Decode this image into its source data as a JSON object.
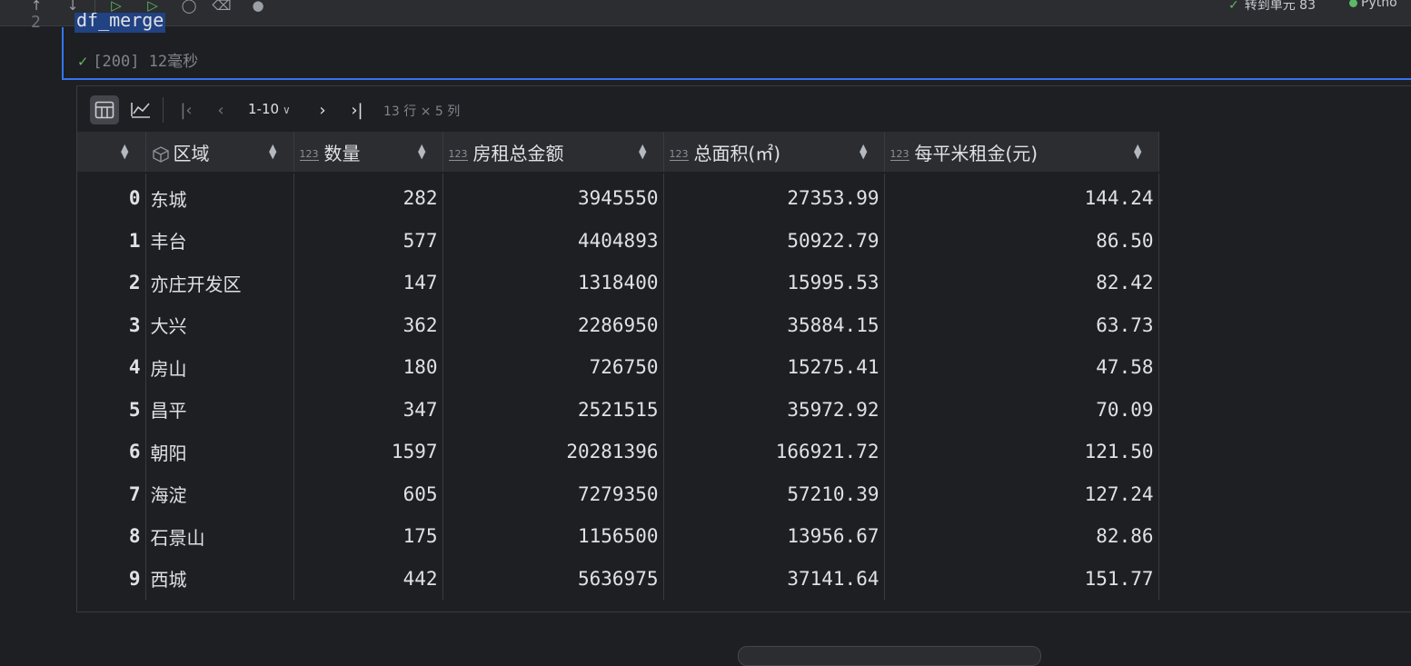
{
  "topbar": {
    "goto_text": "转到单元 83",
    "kernel_text": "Pytho"
  },
  "cell": {
    "line_number": "2",
    "code": "df_merge",
    "status_exec_count": "[200]",
    "status_duration": "12毫秒"
  },
  "output_toolbar": {
    "page_range": "1-10",
    "dims": "13 行 × 5 列"
  },
  "table": {
    "columns": [
      {
        "label": "区域",
        "type": "object"
      },
      {
        "label": "数量",
        "type": "123"
      },
      {
        "label": "房租总金额",
        "type": "123"
      },
      {
        "label": "总面积(㎡)",
        "type": "123"
      },
      {
        "label": "每平米租金(元)",
        "type": "123"
      }
    ],
    "rows": [
      {
        "index": "0",
        "region": "东城",
        "count": "282",
        "total_rent": "3945550",
        "total_area": "27353.99",
        "rent_per_sqm": "144.24"
      },
      {
        "index": "1",
        "region": "丰台",
        "count": "577",
        "total_rent": "4404893",
        "total_area": "50922.79",
        "rent_per_sqm": "86.50"
      },
      {
        "index": "2",
        "region": "亦庄开发区",
        "count": "147",
        "total_rent": "1318400",
        "total_area": "15995.53",
        "rent_per_sqm": "82.42"
      },
      {
        "index": "3",
        "region": "大兴",
        "count": "362",
        "total_rent": "2286950",
        "total_area": "35884.15",
        "rent_per_sqm": "63.73"
      },
      {
        "index": "4",
        "region": "房山",
        "count": "180",
        "total_rent": "726750",
        "total_area": "15275.41",
        "rent_per_sqm": "47.58"
      },
      {
        "index": "5",
        "region": "昌平",
        "count": "347",
        "total_rent": "2521515",
        "total_area": "35972.92",
        "rent_per_sqm": "70.09"
      },
      {
        "index": "6",
        "region": "朝阳",
        "count": "1597",
        "total_rent": "20281396",
        "total_area": "166921.72",
        "rent_per_sqm": "121.50"
      },
      {
        "index": "7",
        "region": "海淀",
        "count": "605",
        "total_rent": "7279350",
        "total_area": "57210.39",
        "rent_per_sqm": "127.24"
      },
      {
        "index": "8",
        "region": "石景山",
        "count": "175",
        "total_rent": "1156500",
        "total_area": "13956.67",
        "rent_per_sqm": "82.86"
      },
      {
        "index": "9",
        "region": "西城",
        "count": "442",
        "total_rent": "5636975",
        "total_area": "37141.64",
        "rent_per_sqm": "151.77"
      }
    ]
  }
}
